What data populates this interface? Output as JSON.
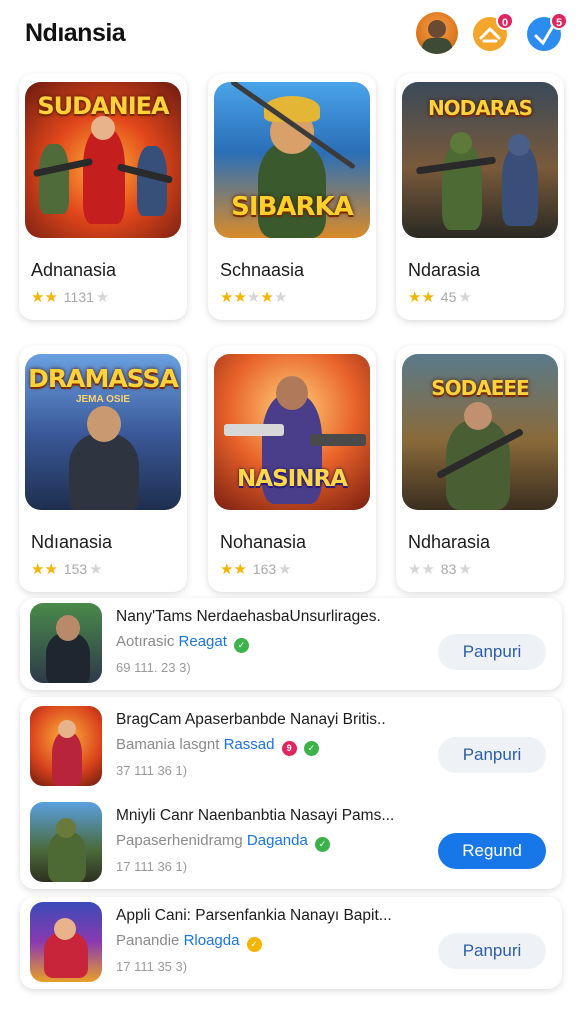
{
  "header": {
    "title": "Ndıansia",
    "badge_1": "0",
    "badge_2": "5"
  },
  "colors": {
    "accent": "#1877e8",
    "star": "#f5b400",
    "badge_red": "#e0245e",
    "button_secondary": "#eef1f5"
  },
  "grid": [
    {
      "name": "Adnanasia",
      "stars": 2,
      "count": "1131",
      "cover_title": "SUDANIEA",
      "cover_sub": ""
    },
    {
      "name": "Schnaasia",
      "stars": 2,
      "count": "",
      "cover_title": "SIBARKA",
      "cover_sub": ""
    },
    {
      "name": "Ndarasia",
      "stars": 2,
      "count": "45",
      "cover_title": "NODARAS",
      "cover_sub": ""
    },
    {
      "name": "Ndıanasia",
      "stars": 2,
      "count": "153",
      "cover_title": "DRAMASSA",
      "cover_sub": "JEMA OSIE"
    },
    {
      "name": "Nohanasia",
      "stars": 2,
      "count": "163",
      "cover_title": "NASINRA",
      "cover_sub": ""
    },
    {
      "name": "Ndharasia",
      "stars": 0,
      "count": "83",
      "cover_title": "SODAEEE",
      "cover_sub": ""
    }
  ],
  "list": [
    {
      "title": "Nany'Tams NerdaehasbaUnsurlirages.",
      "developer": "Aotırasic",
      "dev_link": "Reagat",
      "meta": "69 111. 23 3)",
      "action": "Panpuri",
      "action_style": "secondary"
    },
    {
      "title": "BragCam Apaserbanbde Nanayi Britis..",
      "developer": "Bamania lasgnt",
      "dev_link": "Rassad",
      "meta": "37 111  36 1)",
      "action": "Panpuri",
      "action_style": "secondary"
    },
    {
      "title": "Mniyli Canr Naenbanbtia Nasayi Pams...",
      "developer": "Papaserhenidramg",
      "dev_link": "Daganda",
      "meta": "17 111  36 1)",
      "action": "Regund",
      "action_style": "primary"
    },
    {
      "title": "Appli Cani: Parsenfankia Nanayı Bapit...",
      "developer": "Panandie",
      "dev_link": "Rloagda",
      "meta": "17 111 35 3)",
      "action": "Panpuri",
      "action_style": "secondary"
    }
  ]
}
